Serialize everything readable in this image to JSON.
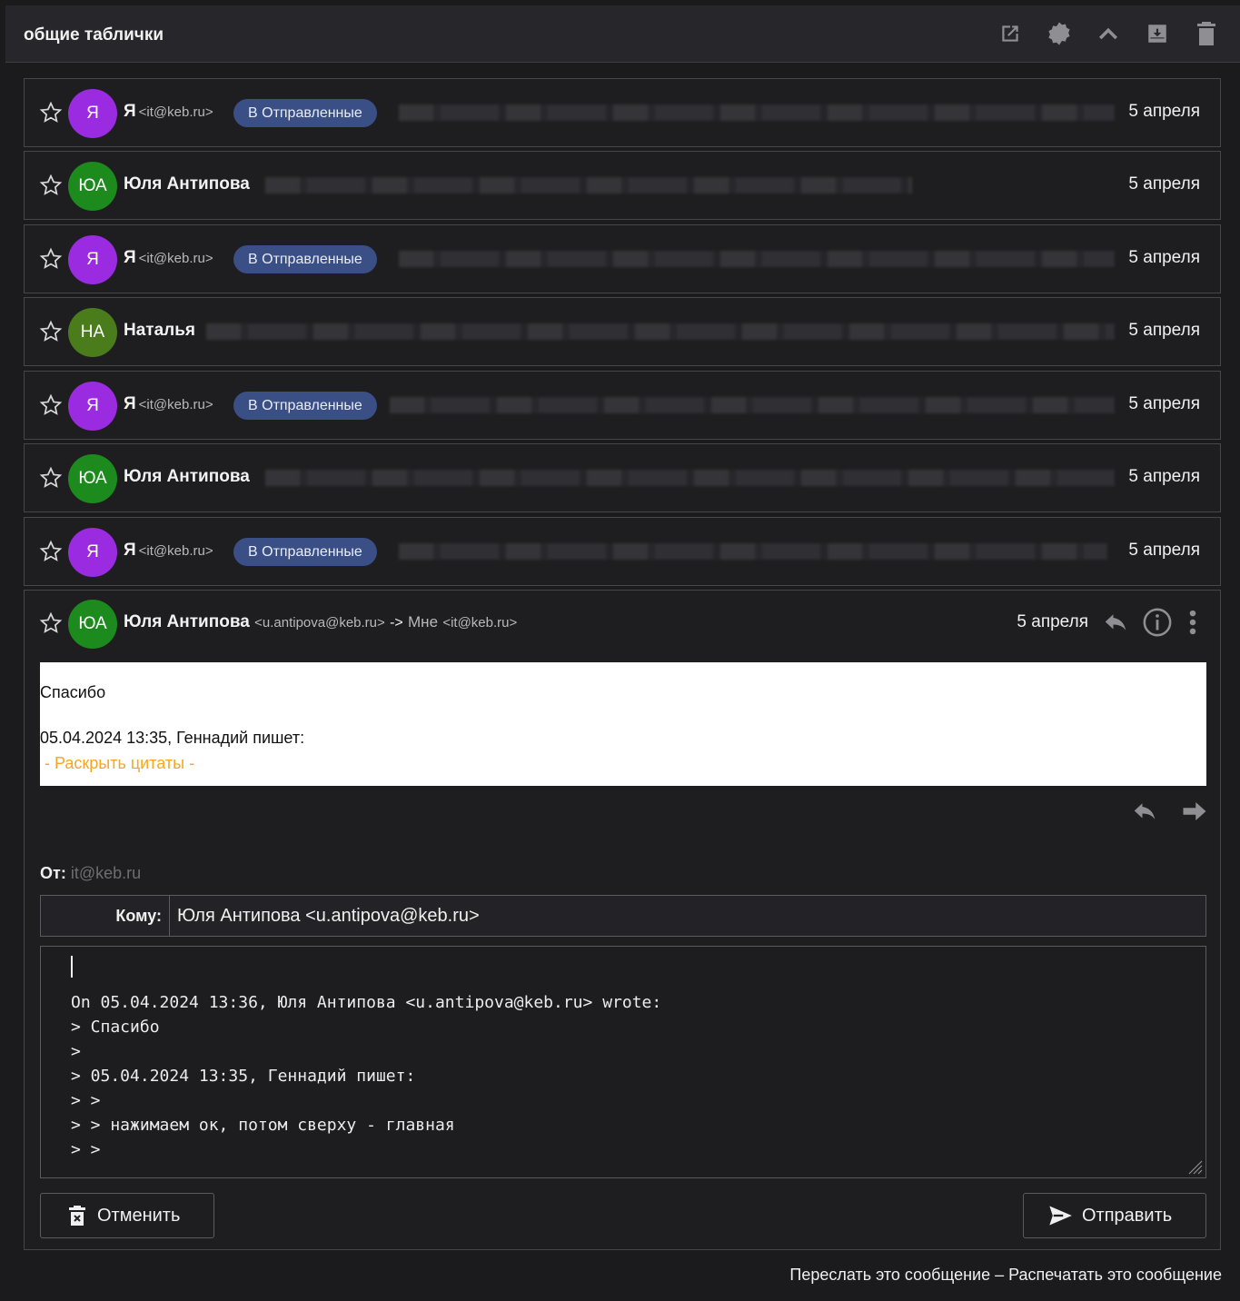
{
  "title": "общие таблички",
  "toolbar_icons": [
    "open-external-icon",
    "settings-icon",
    "collapse-up-icon",
    "archive-icon",
    "trash-icon"
  ],
  "messages": [
    {
      "initials": "Я",
      "avatar_color": "#9b2be0",
      "sender": "Я",
      "email": "<it@keb.ru>",
      "badge": "В Отправленные",
      "date": "5 апреля"
    },
    {
      "initials": "ЮА",
      "avatar_color": "#1c8a1c",
      "sender": "Юля Антипова",
      "email": "",
      "badge": "",
      "date": "5 апреля"
    },
    {
      "initials": "Я",
      "avatar_color": "#9b2be0",
      "sender": "Я",
      "email": "<it@keb.ru>",
      "badge": "В Отправленные",
      "date": "5 апреля"
    },
    {
      "initials": "НА",
      "avatar_color": "#4a7c1c",
      "sender": "Наталья",
      "email": "",
      "badge": "",
      "date": "5 апреля"
    },
    {
      "initials": "Я",
      "avatar_color": "#9b2be0",
      "sender": "Я",
      "email": "<it@keb.ru>",
      "badge": "В Отправленные",
      "date": "5 апреля"
    },
    {
      "initials": "ЮА",
      "avatar_color": "#1c8a1c",
      "sender": "Юля Антипова",
      "email": "",
      "badge": "",
      "date": "5 апреля"
    },
    {
      "initials": "Я",
      "avatar_color": "#9b2be0",
      "sender": "Я",
      "email": "<it@keb.ru>",
      "badge": "В Отправленные",
      "date": "5 апреля"
    }
  ],
  "open_message": {
    "initials": "ЮА",
    "avatar_color": "#1c8a1c",
    "sender": "Юля Антипова",
    "from_email": "<u.antipova@keb.ru>",
    "arrow": "->",
    "to_name": "Мне",
    "to_email": "<it@keb.ru>",
    "date": "5 апреля",
    "body_line1": "Спасибо",
    "body_line2": "05.04.2024 13:35, Геннадий пишет:",
    "expand_quotes": "- Раскрыть цитаты -"
  },
  "compose": {
    "from_label": "От:",
    "from_value": "it@keb.ru",
    "to_label": "Кому:",
    "to_value": "Юля Антипова <u.antipova@keb.ru>",
    "body": "On 05.04.2024 13:36, Юля Антипова <u.antipova@keb.ru> wrote:\n> Спасибо\n>\n> 05.04.2024 13:35, Геннадий пишет:\n> >\n> > нажимаем ок, потом сверху - главная\n> >",
    "cancel_label": "Отменить",
    "send_label": "Отправить"
  },
  "footer": {
    "forward": "Переслать это сообщение",
    "separator": "–",
    "print": "Распечатать это сообщение"
  }
}
